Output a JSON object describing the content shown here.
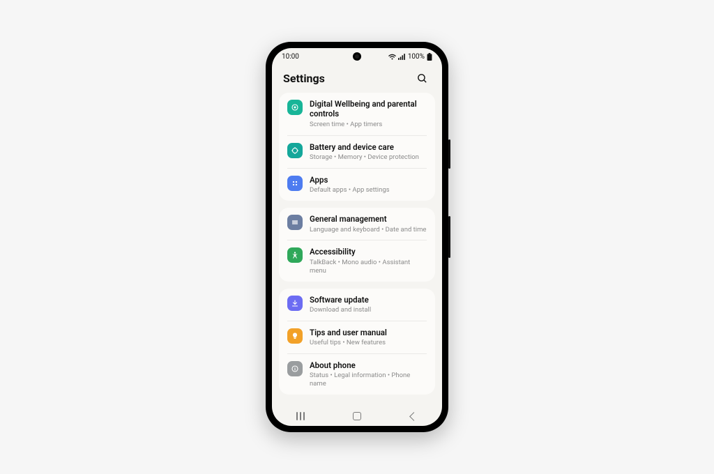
{
  "status": {
    "time": "10:00",
    "battery": "100%"
  },
  "header": {
    "title": "Settings"
  },
  "groups": [
    {
      "items": [
        {
          "title": "Digital Wellbeing and parental controls",
          "subtitle": "Screen time  •  App timers"
        },
        {
          "title": "Battery and device care",
          "subtitle": "Storage  •  Memory  •  Device protection"
        },
        {
          "title": "Apps",
          "subtitle": "Default apps  •  App settings"
        }
      ]
    },
    {
      "items": [
        {
          "title": "General management",
          "subtitle": "Language and keyboard  •  Date and time"
        },
        {
          "title": "Accessibility",
          "subtitle": "TalkBack  •  Mono audio  •  Assistant menu"
        }
      ]
    },
    {
      "items": [
        {
          "title": "Software update",
          "subtitle": "Download and install"
        },
        {
          "title": "Tips and user manual",
          "subtitle": "Useful tips  •  New features"
        },
        {
          "title": "About phone",
          "subtitle": "Status  •  Legal information  •  Phone name"
        }
      ]
    }
  ]
}
